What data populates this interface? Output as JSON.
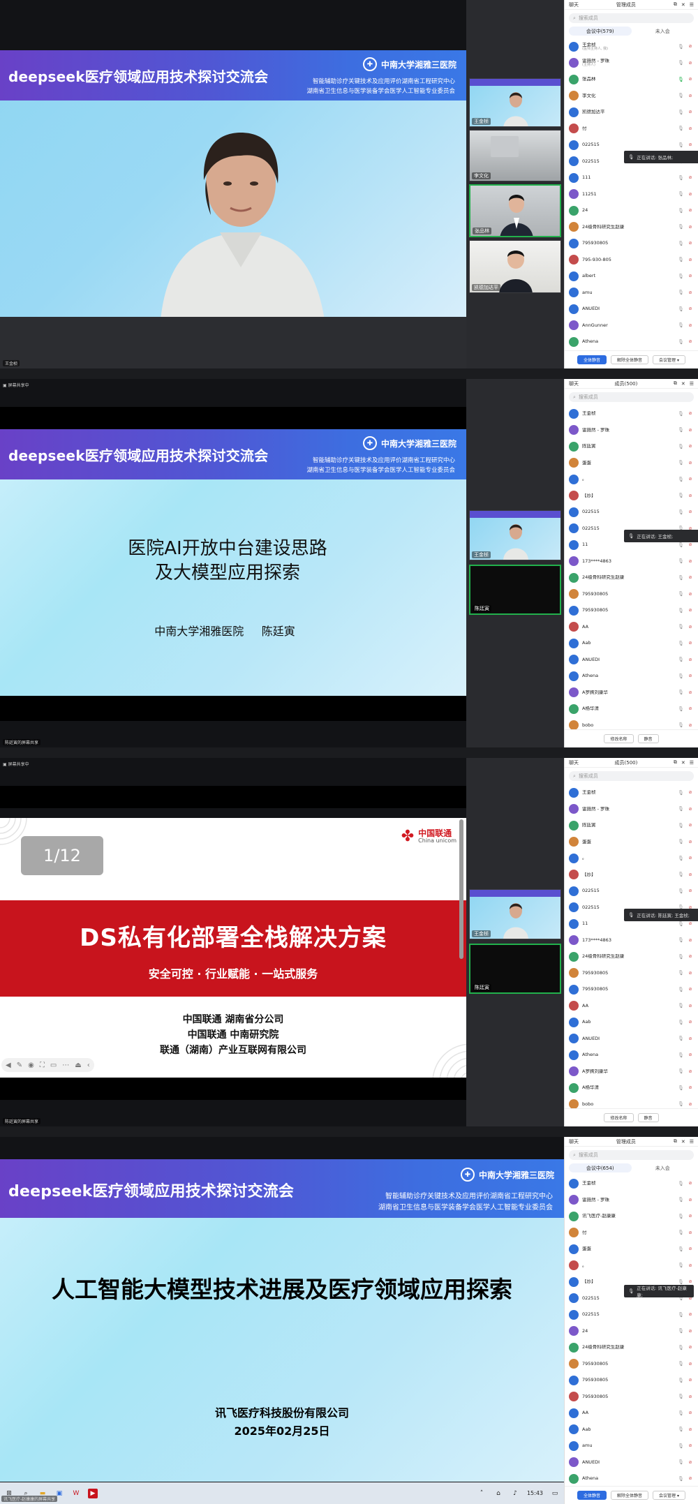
{
  "banner": {
    "title": "deepseek医疗领域应用技术探讨交流会",
    "logo": "中南大学湘雅三医院",
    "sub1": "智能辅助诊疗关键技术及应用评价湖南省工程研究中心",
    "sub2": "湖南省卫生信息与医学装备学会医学人工智能专业委员会"
  },
  "frame1": {
    "speaker": "王金桢",
    "thumbs": [
      "王金桢",
      "李文化",
      "张品林",
      "凯德加达平"
    ],
    "toast": "正在讲话: 张品林;",
    "panel": {
      "header_left": "聊天",
      "header_mid": "管理成员",
      "search": "搜索成员",
      "tab_on": "会议中(579)",
      "tab_off": "未入会",
      "buttons": [
        "全体静音",
        "解除全体静音",
        "会议管理 ▾"
      ]
    },
    "members": [
      {
        "name": "王金桢",
        "note": "(医师主持人, 我)",
        "live": false
      },
      {
        "name": "雷施然 - 罗珠",
        "note": "(主持人)",
        "live": false
      },
      {
        "name": "张品林",
        "note": "",
        "live": true
      },
      {
        "name": "李文化",
        "note": "",
        "live": false
      },
      {
        "name": "凯德加达平",
        "note": "",
        "live": false
      },
      {
        "name": "付",
        "note": "",
        "live": false
      },
      {
        "name": "022515",
        "note": "",
        "live": false
      },
      {
        "name": "022515",
        "note": "",
        "live": false
      },
      {
        "name": "111",
        "note": "",
        "live": false
      },
      {
        "name": "11251",
        "note": "",
        "live": false
      },
      {
        "name": "24",
        "note": "",
        "live": false
      },
      {
        "name": "24级骨科研究生赵康",
        "note": "",
        "live": false
      },
      {
        "name": "795930805",
        "note": "",
        "live": false
      },
      {
        "name": "795-930-805",
        "note": "",
        "live": false
      },
      {
        "name": "albert",
        "note": "",
        "live": false
      },
      {
        "name": "amu",
        "note": "",
        "live": false
      },
      {
        "name": "ANUEDI",
        "note": "",
        "live": false
      },
      {
        "name": "AnnGunner",
        "note": "",
        "live": false
      },
      {
        "name": "Athena",
        "note": "",
        "live": false
      }
    ]
  },
  "frame2": {
    "share_label": "屏幕共享中",
    "speaker": "陈廷寅的屏幕共享",
    "slide_title1": "医院AI开放中台建设思路",
    "slide_title2": "及大模型应用探索",
    "slide_author": "中南大学湘雅医院     陈廷寅",
    "thumbs": [
      "王金桢",
      "陈廷寅"
    ],
    "toast": "正在讲话: 王金桢;",
    "panel": {
      "header_left": "聊天",
      "header_mid": "成员(500)",
      "search": "搜索成员",
      "buttons": [
        "修改名称",
        "静音"
      ]
    },
    "members": [
      "王金桢",
      "雷施然 - 罗珠",
      "陈廷寅",
      "蛋蛋",
      "。",
      "【炒】",
      "022515",
      "022515",
      "11",
      "173****4863",
      "24级骨科研究生赵康",
      "795930805",
      "795930805",
      "AA",
      "Aab",
      "ANUEDI",
      "Athena",
      "A罗腾刘康华",
      "A杨华清",
      "bobo"
    ]
  },
  "frame3": {
    "share_label": "屏幕共享中",
    "speaker": "陈廷寅的屏幕共享",
    "page": "1/12",
    "brand": "中国联通",
    "brand_en": "China unicom",
    "main_title": "DS私有化部署全栈解决方案",
    "tagline": "安全可控 · 行业赋能 · 一站式服务",
    "org1": "中国联通 湖南省分公司",
    "org2": "中国联通 中南研究院",
    "org3": "联通（湖南）产业互联网有限公司",
    "thumbs": [
      "王金桢",
      "陈廷寅"
    ],
    "toast": "正在讲话: 陈廷寅; 王金桢;",
    "panel": {
      "header_left": "聊天",
      "header_mid": "成员(500)",
      "search": "搜索成员",
      "buttons": [
        "修改名称",
        "静音"
      ]
    },
    "members": [
      "王金桢",
      "雷施然 - 罗珠",
      "陈廷寅",
      "蛋蛋",
      "。",
      "【炒】",
      "022515",
      "022515",
      "11",
      "173****4863",
      "24级骨科研究生赵康",
      "795930805",
      "795930805",
      "AA",
      "Aab",
      "ANUEDI",
      "Athena",
      "A罗腾刘康华",
      "A杨华清",
      "bobo"
    ]
  },
  "frame4": {
    "slide_title": "人工智能大模型技术进展及医疗领域应用探索",
    "company": "讯飞医疗科技股份有限公司",
    "date": "2025年02月25日",
    "speaker": "讯飞医疗-赵康康的屏幕共享",
    "toast": "正在讲话: 讯飞医疗-赵康康;",
    "time": "15:43",
    "panel": {
      "header_left": "聊天",
      "header_mid": "管理成员",
      "search": "搜索成员",
      "tab_on": "会议中(654)",
      "tab_off": "未入会",
      "buttons": [
        "全体静音",
        "解除全体静音",
        "会议管理 ▾"
      ]
    },
    "members": [
      "王金桢",
      "雷施然 - 罗珠",
      "讯飞医疗-赵康康",
      "付",
      "蛋蛋",
      "。",
      "【炒】",
      "022515",
      "022515",
      "24",
      "24级骨科研究生赵康",
      "795930805",
      "795930805",
      "795930805",
      "AA",
      "Aab",
      "amu",
      "ANUEDI",
      "Athena"
    ]
  },
  "colors": {
    "banner_start": "#6941c7",
    "banner_end": "#3a78e6",
    "red_band": "#c8141d",
    "accent_green": "#22b14c",
    "accent_blue": "#2d6ce0"
  }
}
